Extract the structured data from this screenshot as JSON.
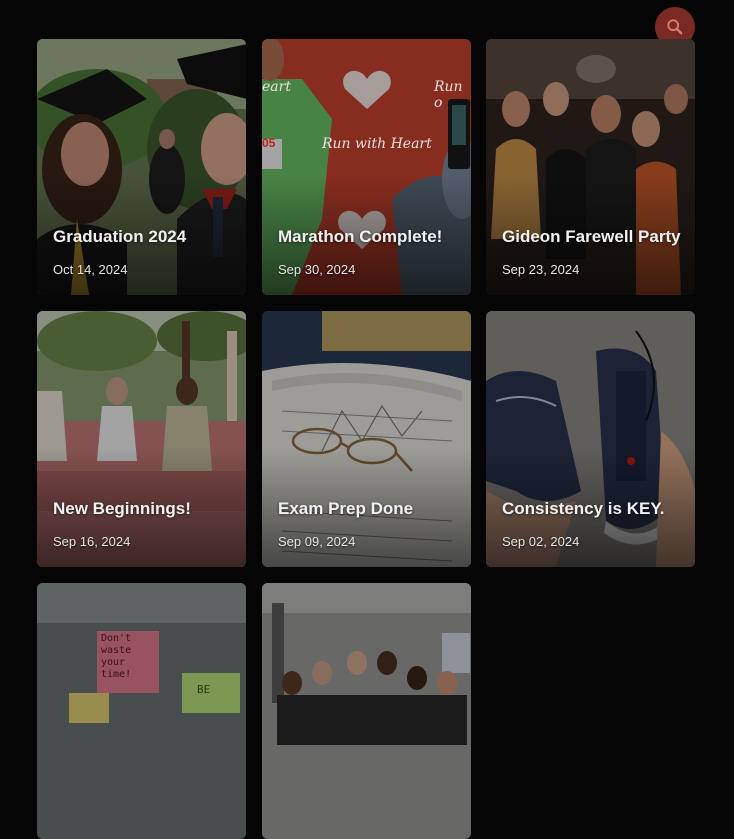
{
  "search": {
    "icon": "search-icon",
    "color": "#7a2a22"
  },
  "cards": [
    {
      "title": "Graduation 2024",
      "date": "Oct 14, 2024"
    },
    {
      "title": "Marathon Complete!",
      "date": "Sep 30, 2024",
      "banner_text_1": "Run with Heart",
      "banner_text_2": "eart",
      "banner_text_3": "Run o",
      "bib": "05"
    },
    {
      "title": "Gideon Farewell Party",
      "date": "Sep 23, 2024"
    },
    {
      "title": "New Beginnings!",
      "date": "Sep 16, 2024"
    },
    {
      "title": "Exam Prep Done",
      "date": "Sep 09, 2024"
    },
    {
      "title": "Consistency is KEY.",
      "date": "Sep 02, 2024"
    },
    {
      "title": "",
      "date": "",
      "note_text": "Don't waste your time!",
      "note2_text": "BE"
    },
    {
      "title": "",
      "date": ""
    }
  ]
}
